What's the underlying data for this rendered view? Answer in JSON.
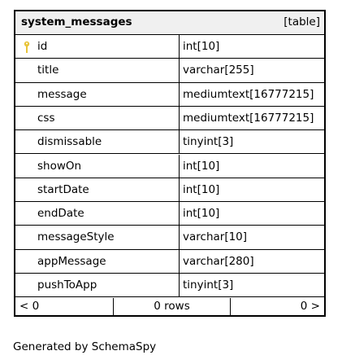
{
  "table": {
    "name": "system_messages",
    "kind": "[table]",
    "columns": [
      {
        "name": "id",
        "type": "int[10]",
        "primary_key": true
      },
      {
        "name": "title",
        "type": "varchar[255]"
      },
      {
        "name": "message",
        "type": "mediumtext[16777215]"
      },
      {
        "name": "css",
        "type": "mediumtext[16777215]"
      },
      {
        "name": "dismissable",
        "type": "tinyint[3]"
      },
      {
        "name": "showOn",
        "type": "int[10]"
      },
      {
        "name": "startDate",
        "type": "int[10]"
      },
      {
        "name": "endDate",
        "type": "int[10]"
      },
      {
        "name": "messageStyle",
        "type": "varchar[10]"
      },
      {
        "name": "appMessage",
        "type": "varchar[280]"
      },
      {
        "name": "pushToApp",
        "type": "tinyint[3]"
      }
    ],
    "footer": {
      "prev": "< 0",
      "rows": "0 rows",
      "next": "0 >"
    }
  },
  "generated_by": "Generated by SchemaSpy",
  "colors": {
    "header_bg": "#f0f0f0",
    "key_icon": "#e8c43a"
  }
}
